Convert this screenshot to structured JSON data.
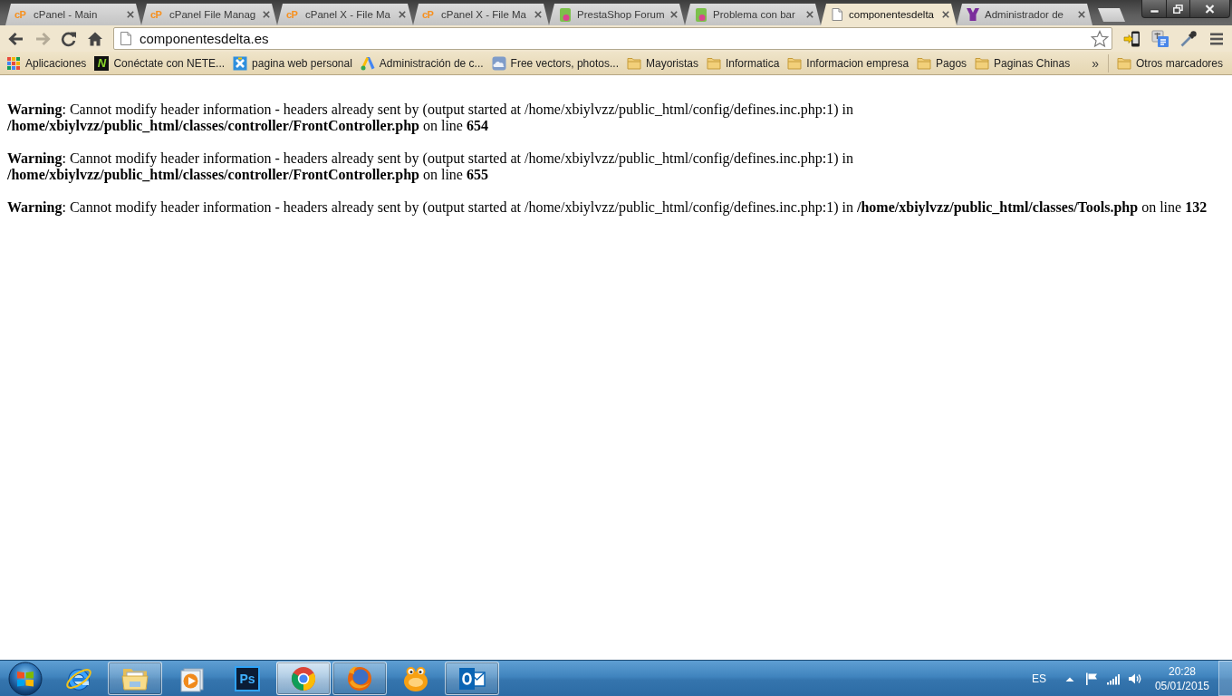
{
  "tabs": [
    {
      "title": "cPanel - Main",
      "kind": "letters",
      "favicon_text": "cP",
      "selected": false
    },
    {
      "title": "cPanel File Manag",
      "kind": "letters",
      "favicon_text": "cP",
      "selected": false
    },
    {
      "title": "cPanel X - File Ma",
      "kind": "letters",
      "favicon_text": "cP",
      "selected": false
    },
    {
      "title": "cPanel X - File Ma",
      "kind": "letters",
      "favicon_text": "cP",
      "selected": false
    },
    {
      "title": "PrestaShop Forum",
      "kind": "bag",
      "selected": false
    },
    {
      "title": "Problema con bar",
      "kind": "bag",
      "selected": false
    },
    {
      "title": "componentesdelta",
      "kind": "page",
      "selected": true
    },
    {
      "title": "Administrador de",
      "kind": "castle",
      "selected": false
    }
  ],
  "toolbar": {
    "nav_buttons": [
      {
        "kind": "back",
        "disabled": false
      },
      {
        "kind": "forward",
        "disabled": true
      },
      {
        "kind": "reload",
        "disabled": false
      },
      {
        "kind": "home",
        "disabled": false
      }
    ],
    "address": "componentesdelta.es",
    "bookmarked": false
  },
  "bookmarks_bar": {
    "items": [
      {
        "label": "Aplicaciones",
        "kind": "apps"
      },
      {
        "label": "Conéctate con NETE...",
        "kind": "letter",
        "icon_text": "N"
      },
      {
        "label": "pagina web personal",
        "kind": "cross"
      },
      {
        "label": "Administración de c...",
        "kind": "triangle"
      },
      {
        "label": "Free vectors, photos...",
        "kind": "cloud"
      },
      {
        "label": "Mayoristas",
        "kind": "folder"
      },
      {
        "label": "Informatica",
        "kind": "folder"
      },
      {
        "label": "Informacion empresa",
        "kind": "folder"
      },
      {
        "label": "Pagos",
        "kind": "folder"
      },
      {
        "label": "Paginas Chinas",
        "kind": "folder"
      }
    ],
    "overflow": "»",
    "other": {
      "label": "Otros marcadores",
      "kind": "folder"
    }
  },
  "page": {
    "warnings": [
      "**Warning**: Cannot modify header information - headers already sent by (output started at /home/xbiylvzz/public_html/config/defines.inc.php:1) in **/home/xbiylvzz/public_html/classes/controller/FrontController.php** on line **654**",
      "**Warning**: Cannot modify header information - headers already sent by (output started at /home/xbiylvzz/public_html/config/defines.inc.php:1) in **/home/xbiylvzz/public_html/classes/controller/FrontController.php** on line **655**",
      "**Warning**: Cannot modify header information - headers already sent by (output started at /home/xbiylvzz/public_html/config/defines.inc.php:1) in **/home/xbiylvzz/public_html/classes/Tools.php** on line **132**"
    ]
  },
  "taskbar": {
    "apps": [
      {
        "kind": "e-orbit",
        "running": false,
        "active": false
      },
      {
        "kind": "folder",
        "running": true,
        "active": false
      },
      {
        "kind": "player",
        "running": false,
        "active": false
      },
      {
        "kind": "letters",
        "icon_text": "Ps",
        "running": false,
        "active": false
      },
      {
        "kind": "ring",
        "running": true,
        "active": true
      },
      {
        "kind": "fox",
        "running": true,
        "active": false
      },
      {
        "kind": "blob",
        "running": false,
        "active": false
      },
      {
        "kind": "mail",
        "running": true,
        "active": false
      }
    ],
    "tray": {
      "language": "ES",
      "time": "20:28",
      "date": "05/01/2015"
    }
  }
}
